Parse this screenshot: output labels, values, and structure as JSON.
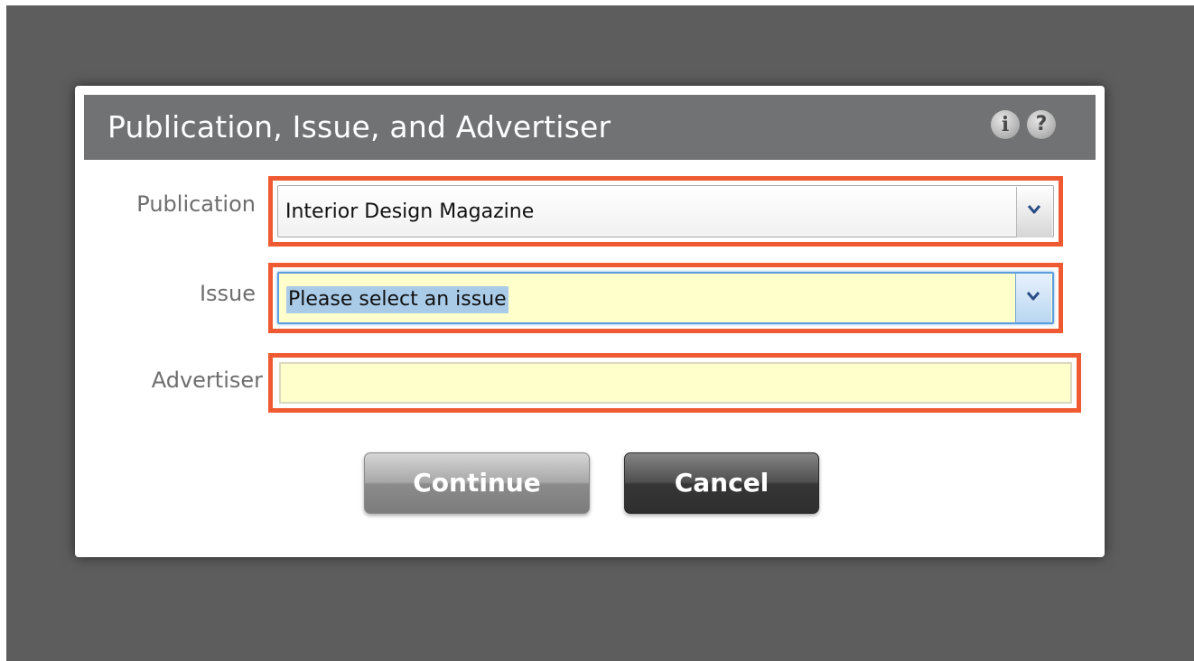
{
  "dialog": {
    "title": "Publication, Issue, and Advertiser",
    "info_icon": "info-icon",
    "help_icon": "help-icon",
    "info_glyph": "i",
    "help_glyph": "?"
  },
  "fields": {
    "publication": {
      "label": "Publication",
      "value": "Interior Design Magazine"
    },
    "issue": {
      "label": "Issue",
      "value": "Please select an issue"
    },
    "advertiser": {
      "label": "Advertiser",
      "value": ""
    }
  },
  "buttons": {
    "continue_label": "Continue",
    "cancel_label": "Cancel"
  },
  "colors": {
    "highlight": "#ef5a32",
    "backdrop": "#5d5d5d",
    "titlebar": "#707273",
    "input_fill": "#ffffcc"
  }
}
